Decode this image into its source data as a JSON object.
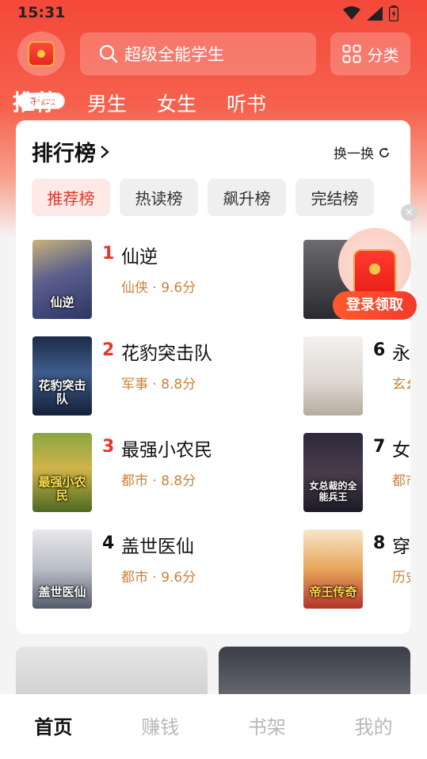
{
  "status_bar": {
    "time": "15:31"
  },
  "header": {
    "gift_label": "待领取",
    "search_placeholder": "超级全能学生",
    "category_label": "分类"
  },
  "top_tabs": [
    {
      "label": "推荐",
      "active": true
    },
    {
      "label": "男生",
      "active": false
    },
    {
      "label": "女生",
      "active": false
    },
    {
      "label": "听书",
      "active": false
    }
  ],
  "ranking": {
    "title": "排行榜",
    "refresh_label": "换一换",
    "chips": [
      {
        "label": "推荐榜",
        "active": true
      },
      {
        "label": "热读榜",
        "active": false
      },
      {
        "label": "飙升榜",
        "active": false
      },
      {
        "label": "完结榜",
        "active": false
      }
    ],
    "books": [
      {
        "rank": "1",
        "name": "仙逆",
        "meta": "仙侠 · 9.6分",
        "cover_title": "仙逆"
      },
      {
        "rank": "2",
        "name": "花豹突击队",
        "meta": "军事 · 8.8分",
        "cover_title": "花豹突击队"
      },
      {
        "rank": "3",
        "name": "最强小农民",
        "meta": "都市 · 8.8分",
        "cover_title": "最强小农民"
      },
      {
        "rank": "4",
        "name": "盖世医仙",
        "meta": "都市 · 9.6分",
        "cover_title": "盖世医仙"
      },
      {
        "rank": "",
        "name": "",
        "meta": "",
        "cover_title": ""
      },
      {
        "rank": "6",
        "name": "永",
        "meta": "玄幺",
        "cover_title": ""
      },
      {
        "rank": "7",
        "name": "女",
        "meta": "都市",
        "cover_title": "女总裁的全能兵王"
      },
      {
        "rank": "8",
        "name": "穿",
        "meta": "历史",
        "cover_title": "帝王传奇"
      }
    ]
  },
  "float_reward": {
    "label": "登录领取",
    "close": "×"
  },
  "bottom_nav": [
    {
      "label": "首页",
      "active": true
    },
    {
      "label": "赚钱",
      "active": false
    },
    {
      "label": "书架",
      "active": false
    },
    {
      "label": "我的",
      "active": false
    }
  ],
  "colors": {
    "brand_red": "#e8352c",
    "meta_orange": "#c8833a",
    "header_red": "#f4483a"
  }
}
